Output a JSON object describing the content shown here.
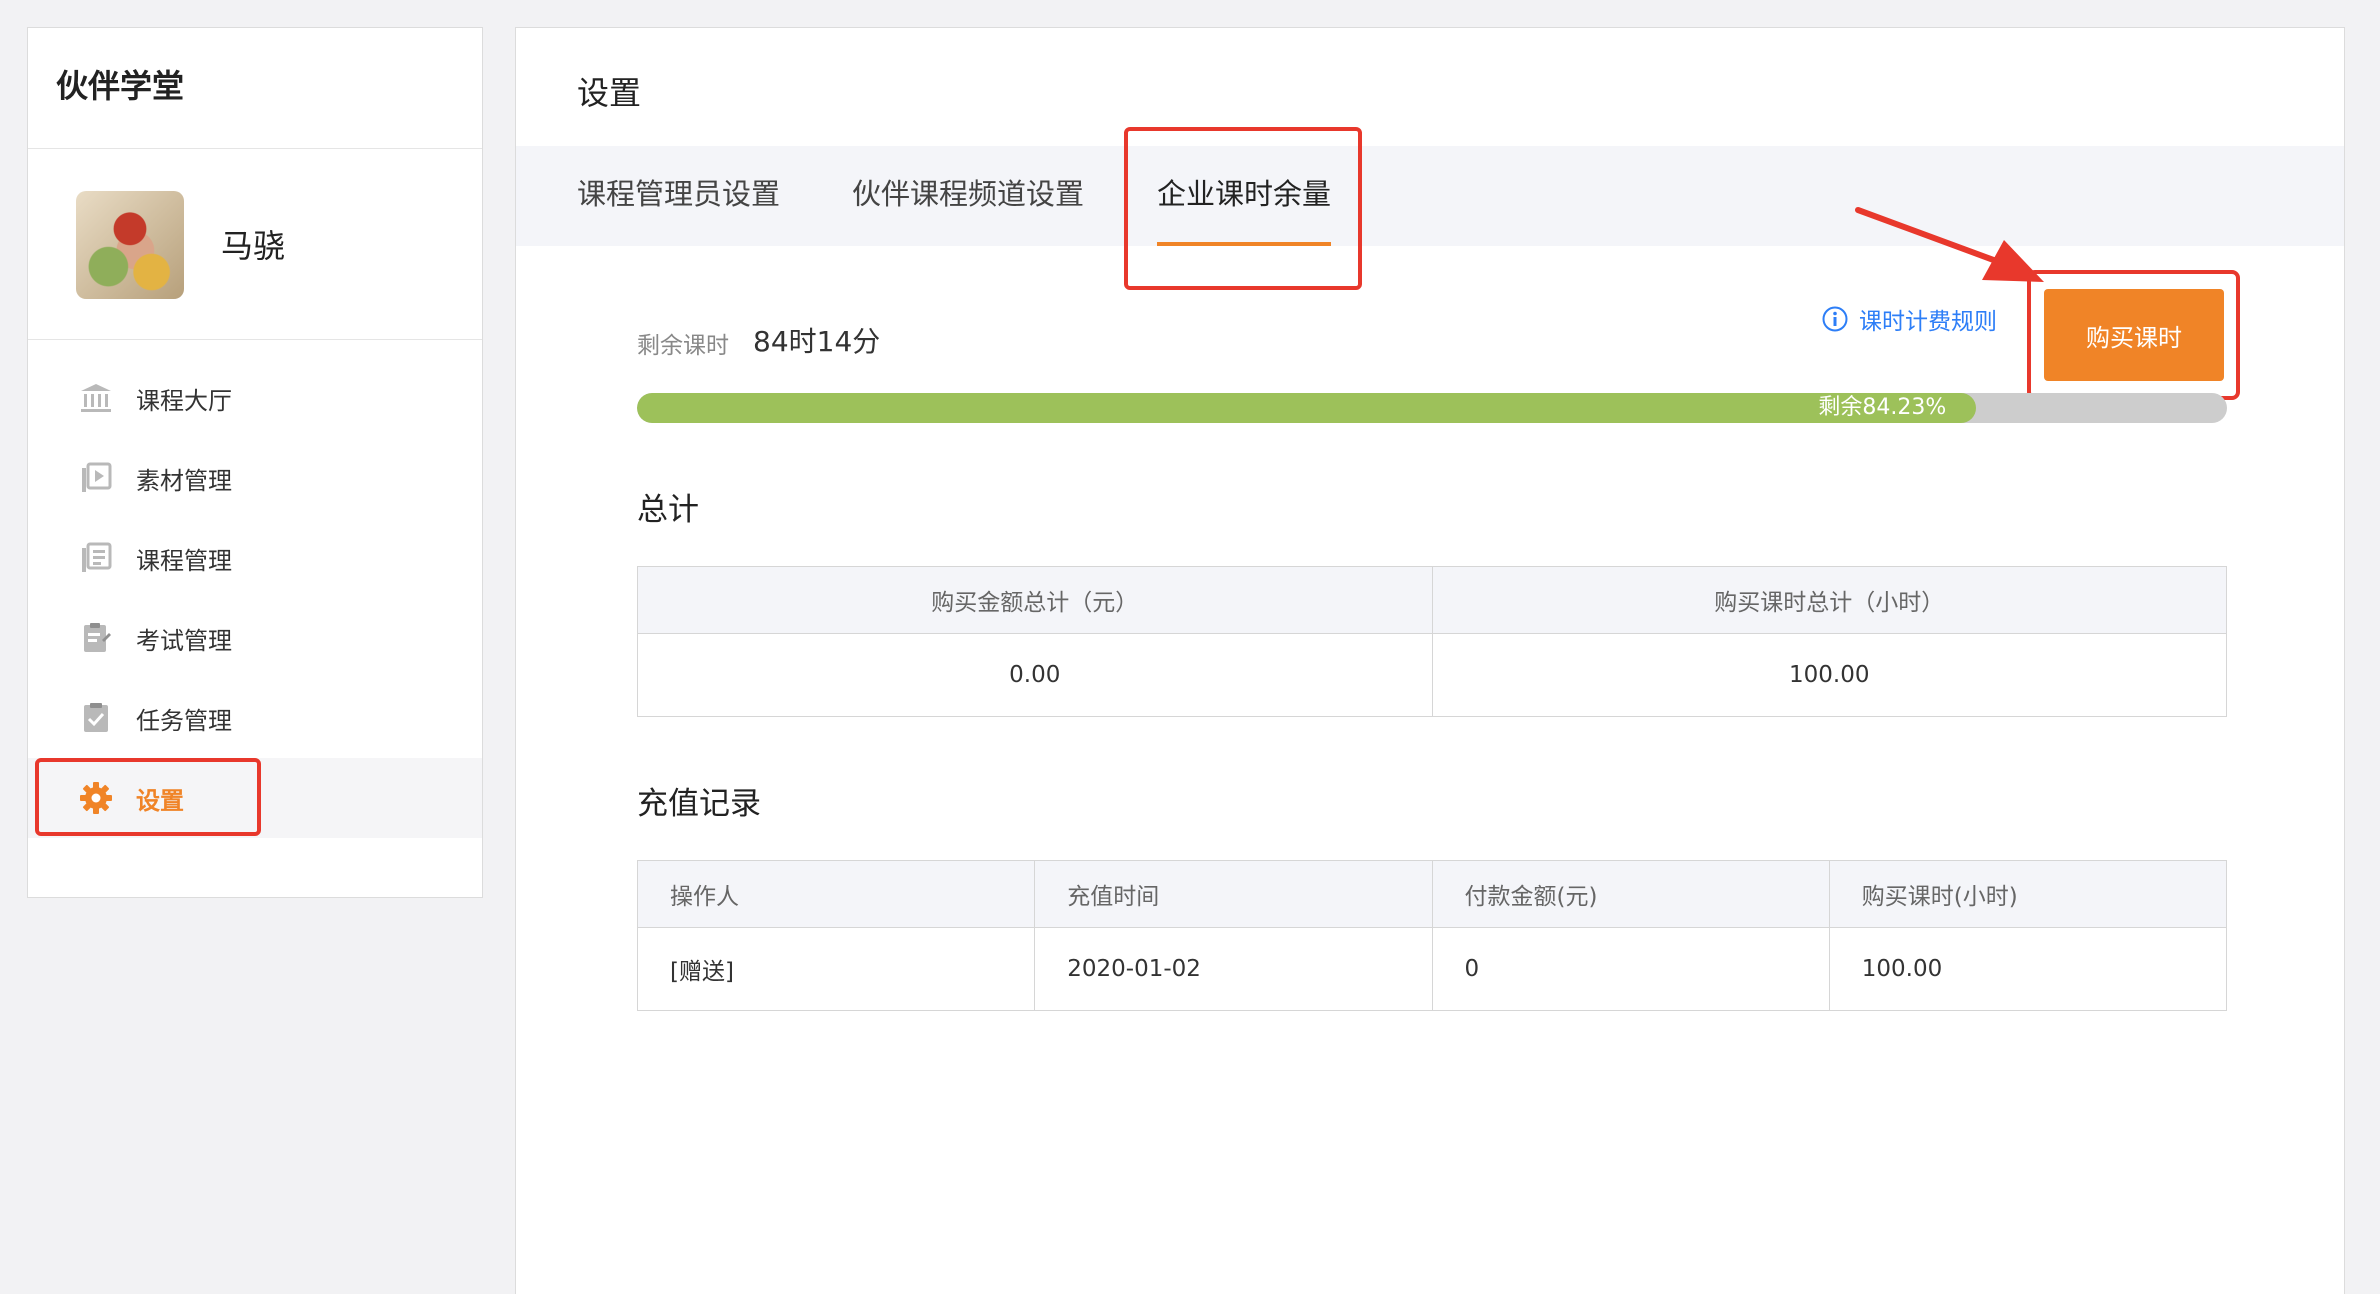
{
  "sidebar": {
    "brand": "伙伴学堂",
    "user_name": "马骁",
    "menu": [
      {
        "label": "课程大厅",
        "icon": "bank-icon"
      },
      {
        "label": "素材管理",
        "icon": "media-library-icon"
      },
      {
        "label": "课程管理",
        "icon": "course-list-icon"
      },
      {
        "label": "考试管理",
        "icon": "exam-clipboard-icon"
      },
      {
        "label": "任务管理",
        "icon": "task-check-icon"
      },
      {
        "label": "设置",
        "icon": "gear-icon",
        "active": true
      }
    ]
  },
  "main": {
    "title": "设置",
    "tabs": [
      {
        "label": "课程管理员设置"
      },
      {
        "label": "伙伴课程频道设置"
      },
      {
        "label": "企业课时余量",
        "active": true
      }
    ],
    "remaining": {
      "label": "剩余课时",
      "value": "84时14分",
      "progress_text": "剩余84.23%",
      "progress_percent": 84.23
    },
    "rules_link": "课时计费规则",
    "buy_button": "购买课时",
    "totals": {
      "title": "总计",
      "headers": [
        "购买金额总计（元）",
        "购买课时总计（小时）"
      ],
      "values": [
        "0.00",
        "100.00"
      ]
    },
    "records": {
      "title": "充值记录",
      "headers": [
        "操作人",
        "充值时间",
        "付款金额(元)",
        "购买课时(小时)"
      ],
      "rows": [
        [
          "[赠送]",
          "2020-01-02",
          "0",
          "100.00"
        ]
      ]
    }
  },
  "colors": {
    "accent": "#f08427",
    "highlight": "#e8382c",
    "progress": "#9dc15a",
    "link": "#2d7ef7"
  }
}
